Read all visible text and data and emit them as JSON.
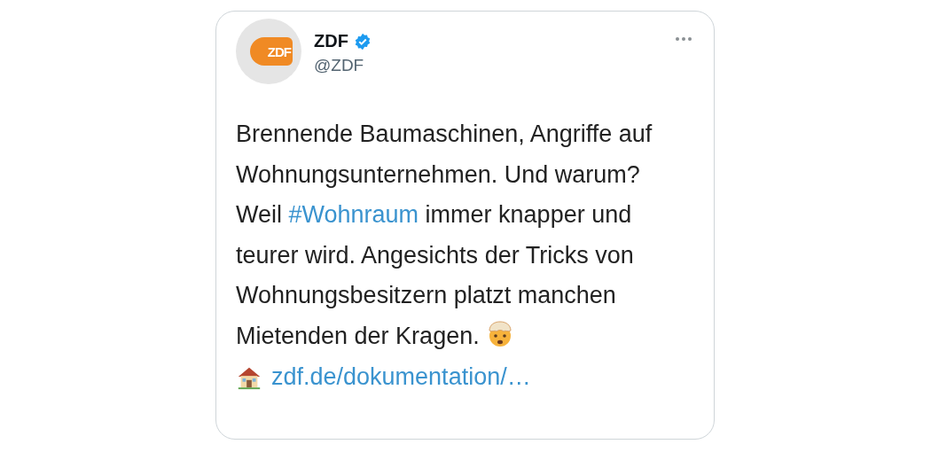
{
  "tweet": {
    "avatar": {
      "logo_text": "ZDF"
    },
    "name": "ZDF",
    "verified": true,
    "handle": "@ZDF",
    "text": [
      {
        "kind": "text",
        "text": "Brennende Baumaschinen, Angriffe auf Wohnungsunternehmen. Und warum? Weil "
      },
      {
        "kind": "hashtag",
        "text": "#Wohnraum"
      },
      {
        "kind": "text",
        "text": " immer knapper und teurer wird. Angesichts der Tricks von Wohnungsbesitzern platzt manchen Mietenden der Kragen."
      },
      {
        "kind": "emoji"
      }
    ],
    "link": {
      "text": "zdf.de/dokumentation/…"
    }
  }
}
